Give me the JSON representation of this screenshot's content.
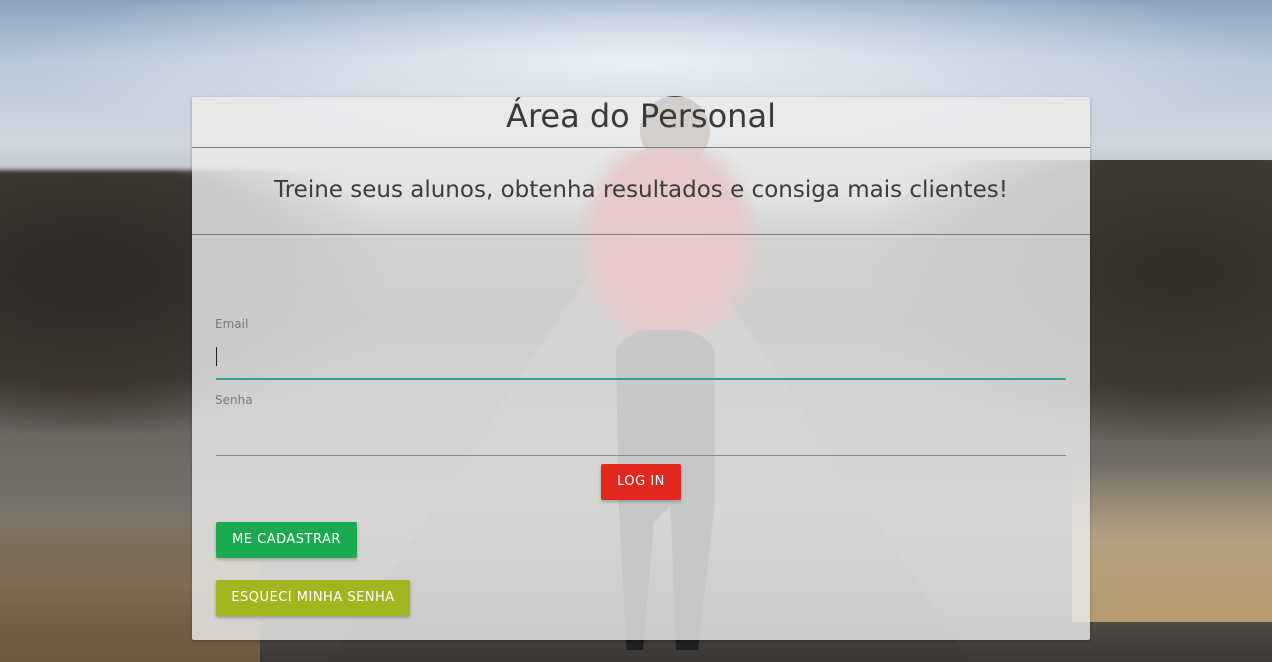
{
  "card": {
    "title": "Área do Personal",
    "subtitle": "Treine seus alunos, obtenha resultados e consiga mais clientes!"
  },
  "form": {
    "email_label": "Email",
    "email_value": "",
    "password_label": "Senha",
    "password_value": ""
  },
  "buttons": {
    "login_label": "LOG IN",
    "register_label": "ME CADASTRAR",
    "forgot_label": "ESQUECI MINHA SENHA"
  },
  "colors": {
    "login_button": "#e0281e",
    "register_button": "#1aaa4f",
    "forgot_button": "#a2b51e",
    "active_input_underline": "#26a69a"
  }
}
